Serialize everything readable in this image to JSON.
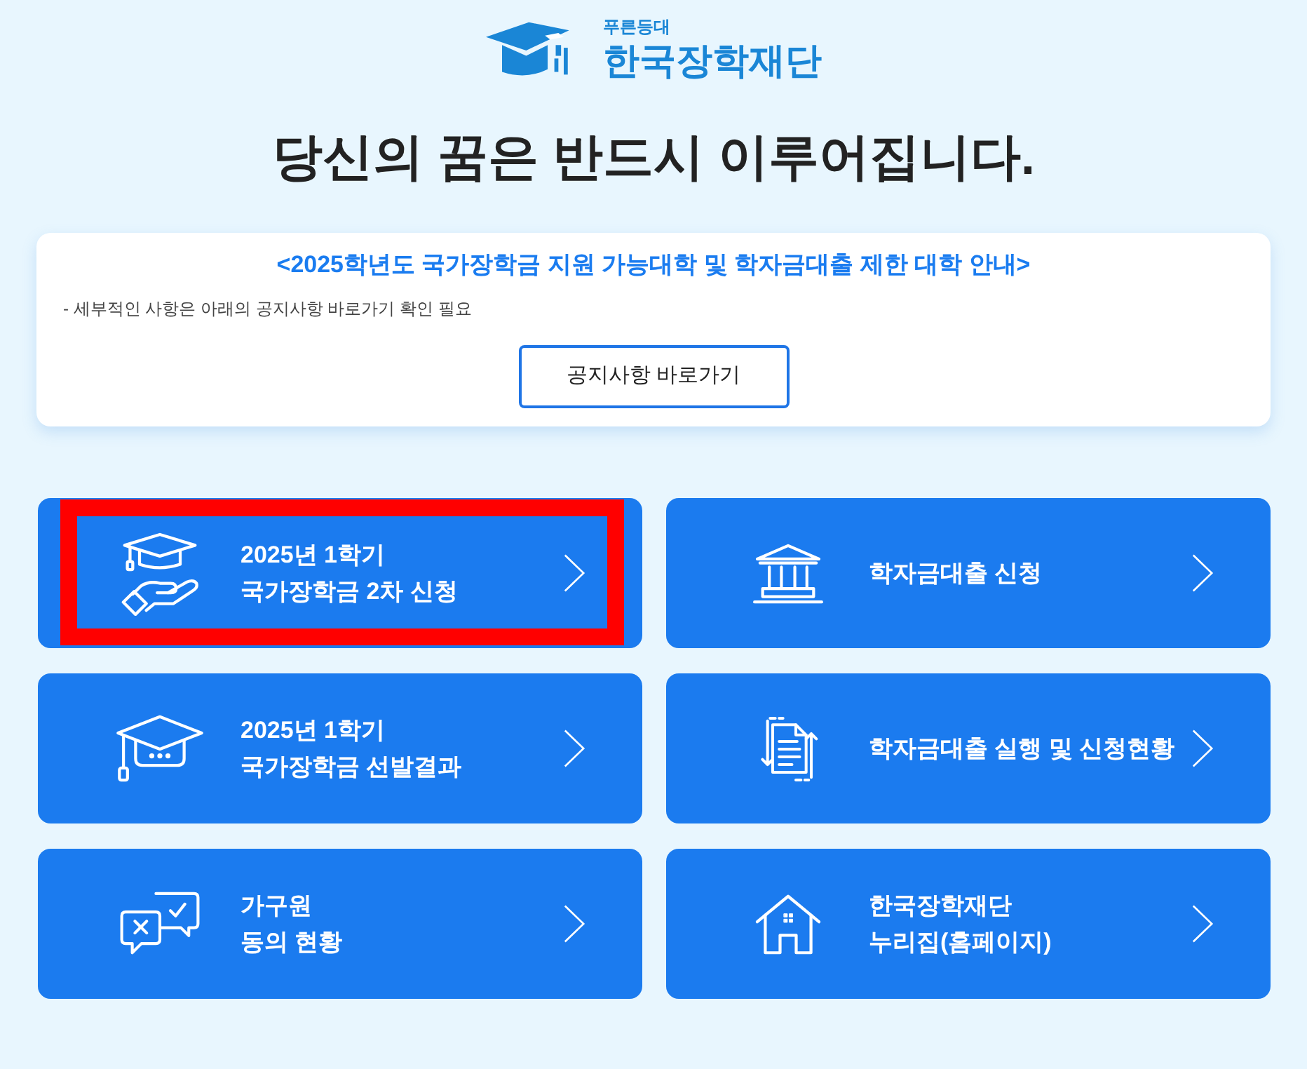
{
  "logo": {
    "tagline": "푸른등대",
    "name": "한국장학재단"
  },
  "headline": "당신의 꿈은 반드시 이루어집니다.",
  "notice": {
    "title": "<2025학년도 국가장학금 지원 가능대학 및 학자금대출 제한 대학 안내>",
    "note": "- 세부적인 사항은 아래의 공지사항 바로가기 확인 필요",
    "button": "공지사항 바로가기"
  },
  "tiles": [
    {
      "lines": [
        "2025년 1학기",
        "국가장학금 2차 신청"
      ],
      "highlighted": true
    },
    {
      "lines": [
        "학자금대출 신청"
      ],
      "highlighted": false
    },
    {
      "lines": [
        "2025년 1학기",
        "국가장학금 선발결과"
      ],
      "highlighted": false
    },
    {
      "lines": [
        "학자금대출 실행 및 신청현황"
      ],
      "highlighted": false
    },
    {
      "lines": [
        "가구원",
        "동의 현황"
      ],
      "highlighted": false
    },
    {
      "lines": [
        "한국장학재단",
        "누리집(홈페이지)"
      ],
      "highlighted": false
    }
  ]
}
